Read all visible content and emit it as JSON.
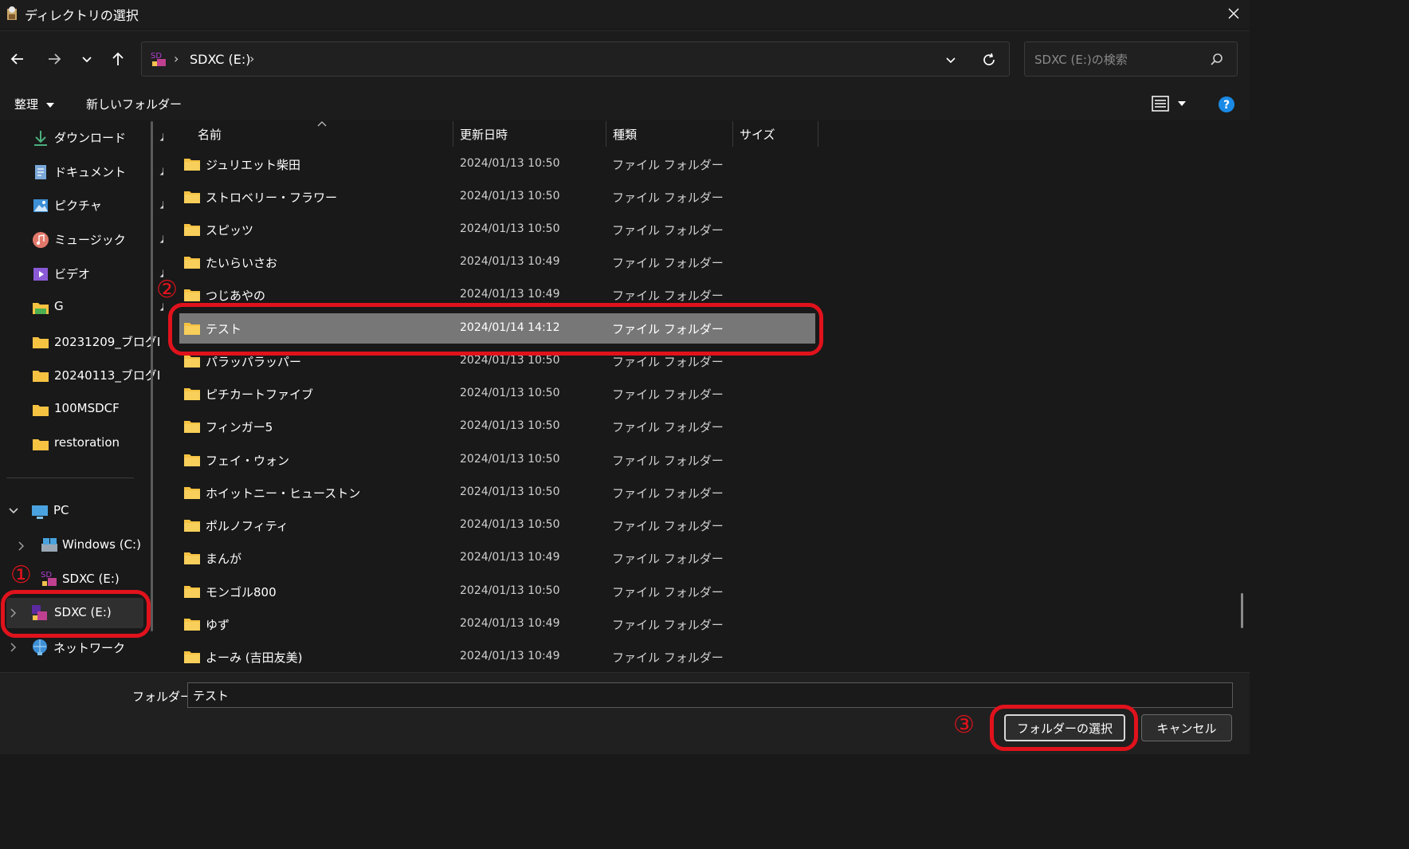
{
  "window": {
    "title": "ディレクトリの選択",
    "close_icon": "close-icon"
  },
  "nav": {
    "path": [
      "SDXC (E:)"
    ],
    "search_placeholder": "SDXC (E:)の検索"
  },
  "toolbar": {
    "organize_label": "整理",
    "new_folder_label": "新しいフォルダー"
  },
  "sidebar": {
    "quick": [
      {
        "label": "ダウンロード",
        "icon": "download-icon",
        "pinned": true
      },
      {
        "label": "ドキュメント",
        "icon": "document-icon",
        "pinned": true
      },
      {
        "label": "ピクチャ",
        "icon": "pictures-icon",
        "pinned": true
      },
      {
        "label": "ミュージック",
        "icon": "music-icon",
        "pinned": true
      },
      {
        "label": "ビデオ",
        "icon": "video-icon",
        "pinned": true
      },
      {
        "label": "G",
        "icon": "folder-icon",
        "pinned": true
      },
      {
        "label": "20231209_ブログI",
        "icon": "folder-icon",
        "pinned": false
      },
      {
        "label": "20240113_ブログI",
        "icon": "folder-icon",
        "pinned": false
      },
      {
        "label": "100MSDCF",
        "icon": "folder-icon",
        "pinned": false
      },
      {
        "label": "restoration",
        "icon": "folder-icon",
        "pinned": false
      }
    ],
    "pc_label": "PC",
    "windows_label": "Windows (C:)",
    "sdxc_child_label": "SDXC (E:)",
    "sdxc_label": "SDXC (E:)",
    "network_label": "ネットワーク"
  },
  "columns": {
    "name": "名前",
    "date": "更新日時",
    "type": "種類",
    "size": "サイズ"
  },
  "files": [
    {
      "name": "ジュリエット柴田",
      "date": "2024/01/13 10:50",
      "type": "ファイル フォルダー"
    },
    {
      "name": "ストロベリー・フラワー",
      "date": "2024/01/13 10:50",
      "type": "ファイル フォルダー"
    },
    {
      "name": "スピッツ",
      "date": "2024/01/13 10:50",
      "type": "ファイル フォルダー"
    },
    {
      "name": "たいらいさお",
      "date": "2024/01/13 10:49",
      "type": "ファイル フォルダー"
    },
    {
      "name": "つじあやの",
      "date": "2024/01/13 10:49",
      "type": "ファイル フォルダー"
    },
    {
      "name": "テスト",
      "date": "2024/01/14 14:12",
      "type": "ファイル フォルダー",
      "selected": true
    },
    {
      "name": "パラッパラッパー",
      "date": "2024/01/13 10:50",
      "type": "ファイル フォルダー"
    },
    {
      "name": "ピチカートファイブ",
      "date": "2024/01/13 10:50",
      "type": "ファイル フォルダー"
    },
    {
      "name": "フィンガー5",
      "date": "2024/01/13 10:50",
      "type": "ファイル フォルダー"
    },
    {
      "name": "フェイ・ウォン",
      "date": "2024/01/13 10:50",
      "type": "ファイル フォルダー"
    },
    {
      "name": "ホイットニー・ヒューストン",
      "date": "2024/01/13 10:50",
      "type": "ファイル フォルダー"
    },
    {
      "name": "ポルノフィティ",
      "date": "2024/01/13 10:50",
      "type": "ファイル フォルダー"
    },
    {
      "name": "まんが",
      "date": "2024/01/13 10:49",
      "type": "ファイル フォルダー"
    },
    {
      "name": "モンゴル800",
      "date": "2024/01/13 10:50",
      "type": "ファイル フォルダー"
    },
    {
      "name": "ゆず",
      "date": "2024/01/13 10:49",
      "type": "ファイル フォルダー"
    },
    {
      "name": "よーみ (吉田友美)",
      "date": "2024/01/13 10:49",
      "type": "ファイル フォルダー"
    }
  ],
  "footer": {
    "folder_label": "フォルダー:",
    "folder_value": "テスト",
    "select_button": "フォルダーの選択",
    "cancel_button": "キャンセル"
  },
  "annotations": {
    "step1": "①",
    "step2": "②",
    "step3": "③",
    "color": "#e0121c"
  },
  "colors": {
    "accent": "#0078d4",
    "folder": "#f5c242",
    "selected_row": "#777777"
  }
}
